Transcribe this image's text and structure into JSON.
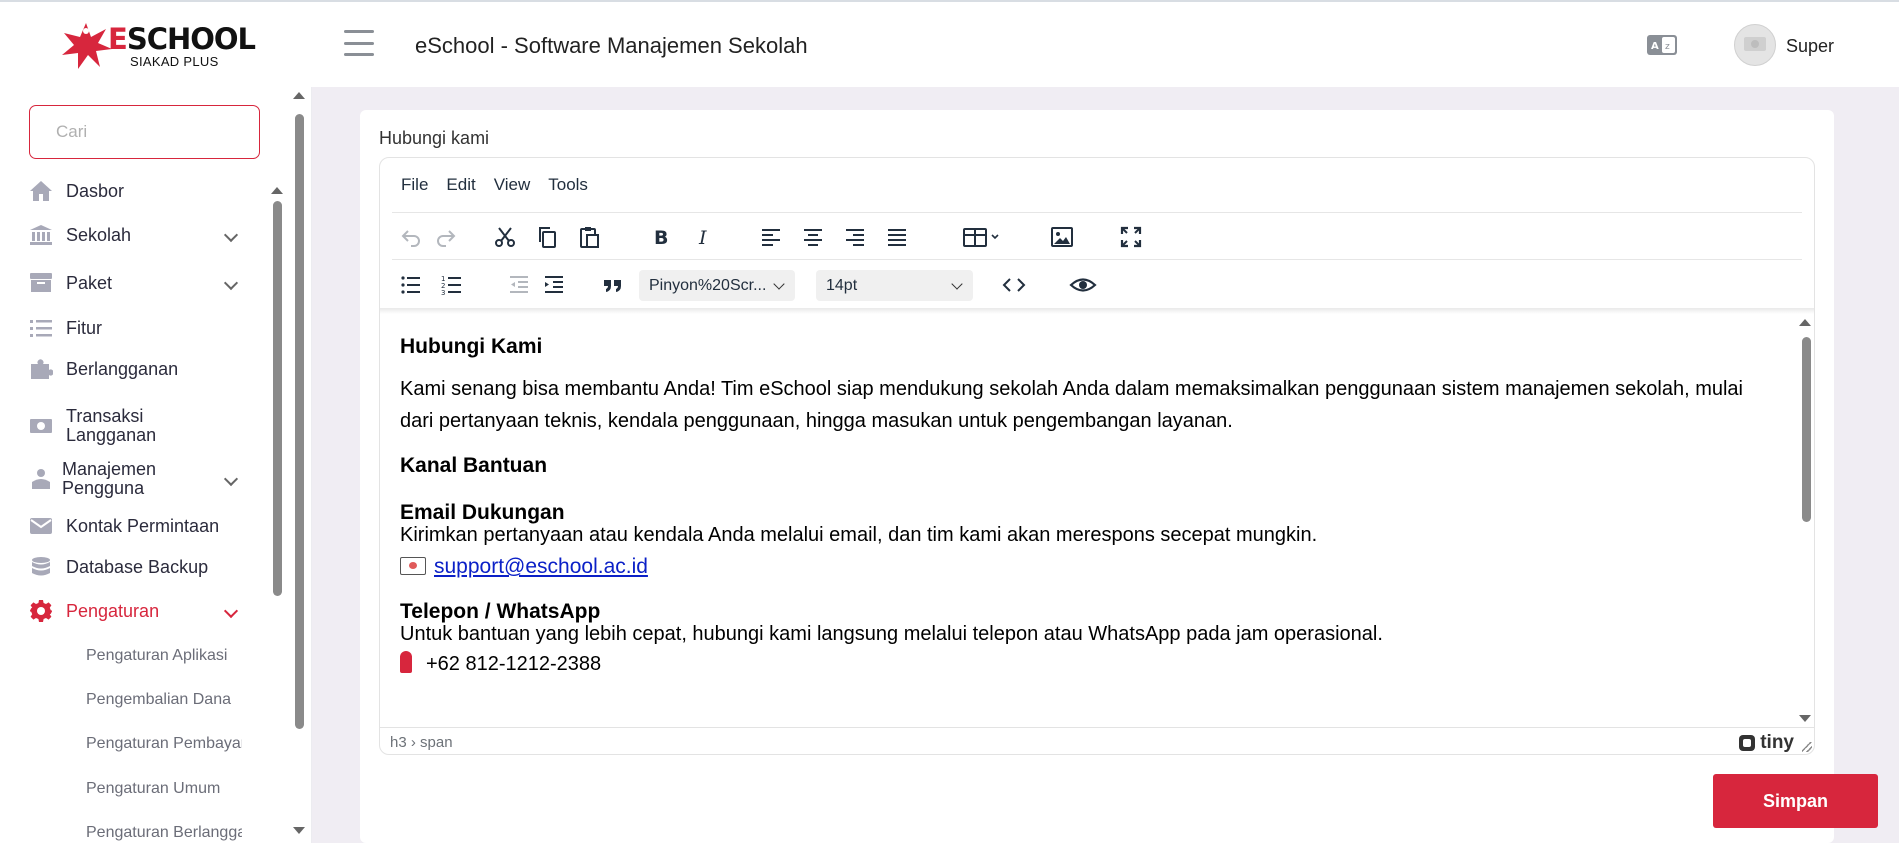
{
  "brand": {
    "name_prefix": "E",
    "name_rest": "SCHOOL",
    "tagline": "SIAKAD PLUS",
    "accent": "#d7263d"
  },
  "header": {
    "title": "eSchool - Software Manajemen Sekolah",
    "user_name": "Super"
  },
  "sidebar": {
    "search_placeholder": "Cari",
    "items": [
      {
        "label": "Dasbor",
        "icon": "home-icon"
      },
      {
        "label": "Sekolah",
        "icon": "bank-icon",
        "has_children": true
      },
      {
        "label": "Paket",
        "icon": "archive-icon",
        "has_children": true
      },
      {
        "label": "Fitur",
        "icon": "list-icon"
      },
      {
        "label": "Berlangganan",
        "icon": "puzzle-icon"
      },
      {
        "label": "Transaksi Langganan",
        "icon": "money-icon"
      },
      {
        "label": "Manajemen Pengguna",
        "icon": "user-group-icon",
        "has_children": true
      },
      {
        "label": "Kontak Permintaan",
        "icon": "envelope-icon"
      },
      {
        "label": "Database Backup",
        "icon": "database-icon"
      },
      {
        "label": "Pengaturan",
        "icon": "gear-icon",
        "has_children": true,
        "active": true
      }
    ],
    "sub_items": [
      "Pengaturan Aplikasi",
      "Pengembalian Dana",
      "Pengaturan Pembayaran",
      "Pengaturan Umum",
      "Pengaturan Berlangganan"
    ]
  },
  "page": {
    "field_label": "Hubungi kami",
    "save_label": "Simpan"
  },
  "editor": {
    "menu": [
      "File",
      "Edit",
      "View",
      "Tools"
    ],
    "font_family": "Pinyon%20Scr...",
    "font_size": "14pt",
    "path": "h3 › span",
    "brand": "tiny",
    "content": {
      "h_title": "Hubungi Kami",
      "intro": "Kami senang bisa membantu Anda! Tim eSchool siap mendukung sekolah Anda dalam memaksimalkan penggunaan sistem manajemen sekolah, mulai dari pertanyaan teknis, kendala penggunaan, hingga masukan untuk pengembangan layanan.",
      "h_channels": "Kanal Bantuan",
      "h_email": "Email Dukungan",
      "email_desc": "Kirimkan pertanyaan atau kendala Anda melalui email, dan tim kami akan merespons secepat mungkin.",
      "email": "support@eschool.ac.id",
      "h_phone": "Telepon / WhatsApp",
      "phone_desc": "Untuk bantuan yang lebih cepat, hubungi kami langsung melalui telepon atau WhatsApp pada jam operasional.",
      "phone": "+62 812-1212-2388"
    }
  }
}
